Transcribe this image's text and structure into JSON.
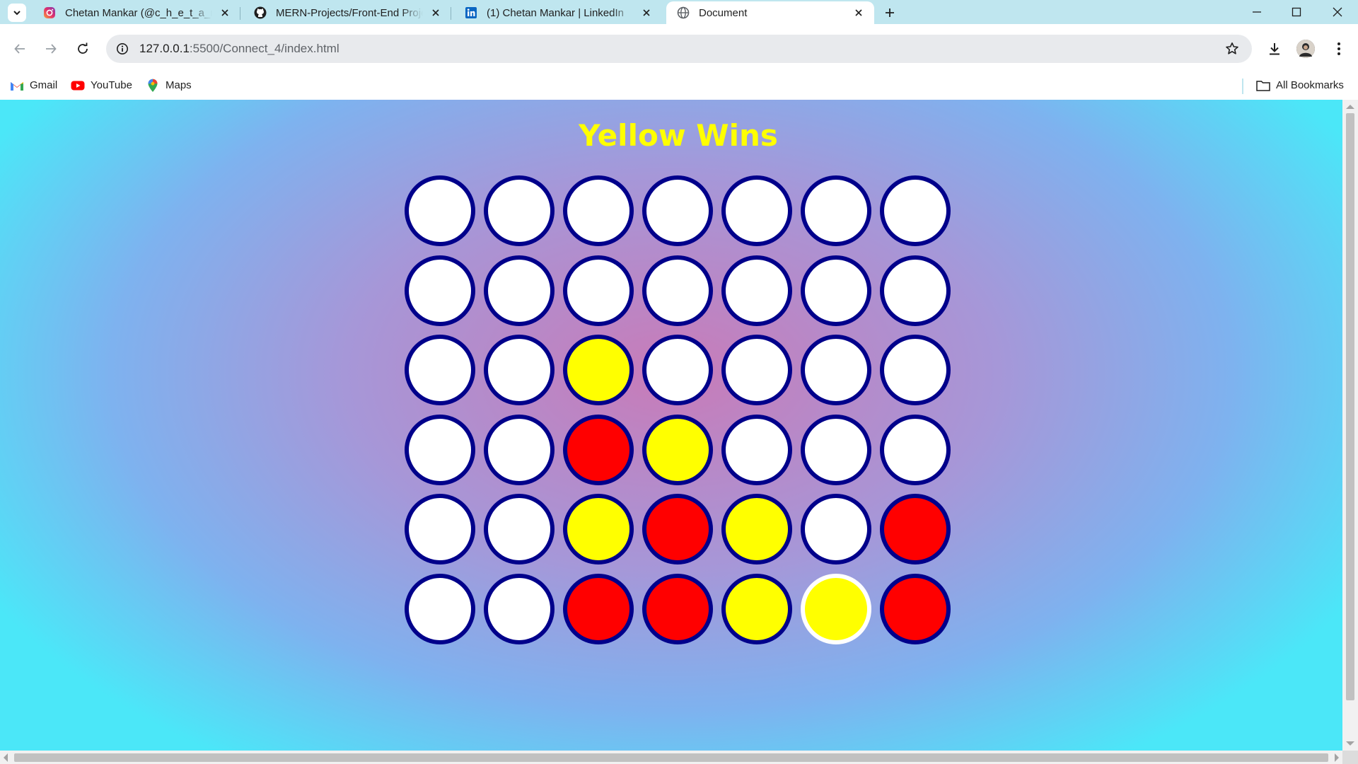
{
  "browser": {
    "tabs": [
      {
        "title": "Chetan Mankar (@c_h_e_t_a_n_",
        "icon": "instagram-icon",
        "active": false
      },
      {
        "title": "MERN-Projects/Front-End Proje",
        "icon": "github-icon",
        "active": false
      },
      {
        "title": "(1) Chetan Mankar | LinkedIn",
        "icon": "linkedin-icon",
        "active": false
      },
      {
        "title": "Document",
        "icon": "globe-icon",
        "active": true
      }
    ],
    "url_host": "127.0.0.1",
    "url_path": ":5500/Connect_4/index.html",
    "bookmarks": [
      {
        "label": "Gmail",
        "icon": "gmail-icon"
      },
      {
        "label": "YouTube",
        "icon": "youtube-icon"
      },
      {
        "label": "Maps",
        "icon": "maps-icon"
      }
    ],
    "all_bookmarks_label": "All Bookmarks"
  },
  "game": {
    "status": "Yellow Wins",
    "status_color": "#ffff00",
    "colors": {
      "empty": "#ffffff",
      "red": "#ff0000",
      "yellow": "#ffff00",
      "cell_border": "#00008b",
      "last_move_border": "#ffffff"
    },
    "board": [
      [
        "empty",
        "empty",
        "empty",
        "empty",
        "empty",
        "empty",
        "empty"
      ],
      [
        "empty",
        "empty",
        "empty",
        "empty",
        "empty",
        "empty",
        "empty"
      ],
      [
        "empty",
        "empty",
        "yellow",
        "empty",
        "empty",
        "empty",
        "empty"
      ],
      [
        "empty",
        "empty",
        "red",
        "yellow",
        "empty",
        "empty",
        "empty"
      ],
      [
        "empty",
        "empty",
        "yellow",
        "red",
        "yellow",
        "empty",
        "red"
      ],
      [
        "empty",
        "empty",
        "red",
        "red",
        "yellow",
        "yellow",
        "red"
      ]
    ],
    "last_move": {
      "row": 5,
      "col": 5
    }
  }
}
